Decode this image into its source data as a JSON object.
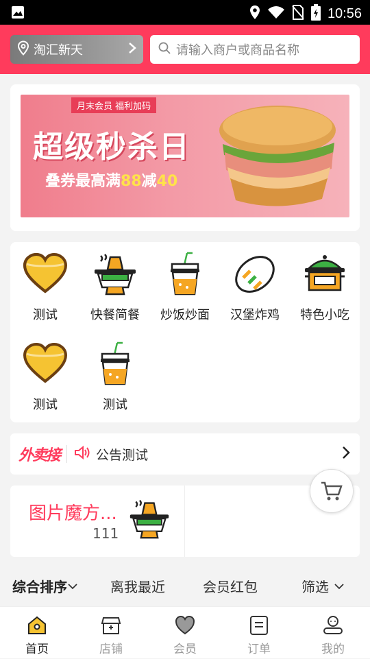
{
  "status_bar": {
    "time": "10:56"
  },
  "header": {
    "location": "淘汇新天",
    "search_placeholder": "请输入商户或商品名称"
  },
  "banner": {
    "tag": "月末会员 福利加码",
    "headline": "超级秒杀日",
    "subline_prefix": "叠券最高满",
    "subline_a": "88",
    "subline_mid": "减",
    "subline_b": "40"
  },
  "categories": [
    {
      "label": "测试",
      "icon": "heart-icon"
    },
    {
      "label": "快餐简餐",
      "icon": "hotpot-icon"
    },
    {
      "label": "炒饭炒面",
      "icon": "drink-cup-icon"
    },
    {
      "label": "汉堡炸鸡",
      "icon": "bread-icon"
    },
    {
      "label": "特色小吃",
      "icon": "pot-icon"
    },
    {
      "label": "测试",
      "icon": "heart-icon"
    },
    {
      "label": "测试",
      "icon": "drink-cup-icon"
    }
  ],
  "notice": {
    "brand": "外卖接",
    "text": "公告测试"
  },
  "magic_cube": {
    "title": "图片魔方...",
    "value": "111"
  },
  "sort_options": [
    {
      "label": "综合排序",
      "active": true
    },
    {
      "label": "离我最近",
      "active": false
    },
    {
      "label": "会员红包",
      "active": false
    },
    {
      "label": "筛选",
      "active": false
    }
  ],
  "tabs": [
    {
      "label": "首页",
      "icon": "home-icon",
      "active": true
    },
    {
      "label": "店铺",
      "icon": "store-icon",
      "active": false
    },
    {
      "label": "会员",
      "icon": "member-heart-icon",
      "active": false
    },
    {
      "label": "订单",
      "icon": "order-icon",
      "active": false
    },
    {
      "label": "我的",
      "icon": "profile-icon",
      "active": false
    }
  ],
  "colors": {
    "accent": "#ff3b5c",
    "yellow": "#f5c332",
    "brown": "#6b3f12"
  }
}
